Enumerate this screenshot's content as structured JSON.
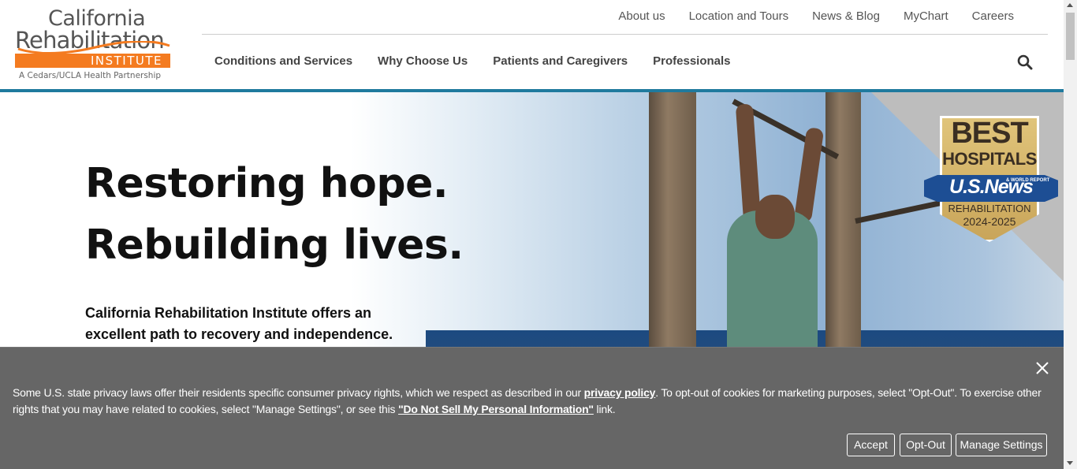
{
  "logo": {
    "line1": "California",
    "line2": "Rehabilitation",
    "line3": "INSTITUTE",
    "tagline": "A Cedars/UCLA Health Partnership"
  },
  "utility_nav": [
    "About us",
    "Location and Tours",
    "News & Blog",
    "MyChart",
    "Careers"
  ],
  "main_nav": [
    "Conditions and Services",
    "Why Choose Us",
    "Patients and Caregivers",
    "Professionals"
  ],
  "search": {
    "icon": "search-icon"
  },
  "hero": {
    "title_line1": "Restoring hope.",
    "title_line2": "Rebuilding lives.",
    "subtitle": "California Rehabilitation Institute offers an excellent path to recovery and independence."
  },
  "badge": {
    "best": "BEST",
    "hospitals": "HOSPITALS",
    "brand": "U.S.News",
    "report": "& WORLD REPORT",
    "category": "REHABILITATION",
    "years": "2024-2025"
  },
  "cookie_banner": {
    "text_before": "Some U.S. state privacy laws offer their residents specific consumer privacy rights, which we respect as described in our ",
    "privacy_link": "privacy policy",
    "text_middle": ". To opt-out of cookies for marketing purposes, select \"Opt-Out\". To exercise other rights that you may have related to cookies, select \"Manage Settings\", or see this ",
    "dns_link": "\"Do Not Sell My Personal Information\"",
    "text_after": " link.",
    "accept_label": "Accept",
    "optout_label": "Opt-Out",
    "manage_label": "Manage Settings"
  },
  "colors": {
    "brand_orange": "#f47b20",
    "accent_blue": "#1f7a9e",
    "banner_gray": "#666666"
  }
}
